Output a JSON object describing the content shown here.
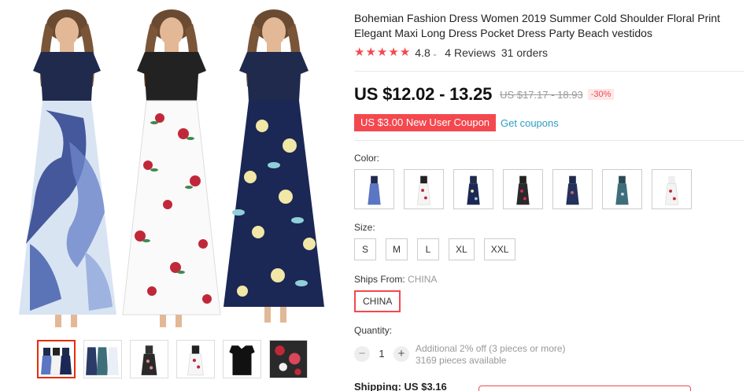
{
  "product": {
    "title": "Bohemian Fashion Dress Women 2019 Summer Cold Shoulder Floral Print Elegant Maxi Long Dress Pocket Dress Party Beach vestidos",
    "rating": "4.8",
    "reviews": "4 Reviews",
    "orders": "31 orders",
    "price": "US $12.02 - 13.25",
    "original_price": "US $17.17 - 18.93",
    "discount": "-30%",
    "coupon": "US $3.00 New User Coupon",
    "get_coupons": "Get coupons"
  },
  "colors": {
    "label": "Color:",
    "swatches": [
      {
        "name": "blue-floral"
      },
      {
        "name": "white-floral"
      },
      {
        "name": "navy-floral"
      },
      {
        "name": "black-rose"
      },
      {
        "name": "navy-print"
      },
      {
        "name": "teal-print"
      },
      {
        "name": "white-navy"
      }
    ]
  },
  "sizes": {
    "label": "Size:",
    "options": [
      "S",
      "M",
      "L",
      "XL",
      "XXL"
    ]
  },
  "ships_from": {
    "label": "Ships From:",
    "value": "CHINA",
    "option": "CHINA"
  },
  "quantity": {
    "label": "Quantity:",
    "minus": "−",
    "plus": "+",
    "value": "1",
    "note": "Additional 2% off (3 pieces or more)",
    "available": "3169 pieces available"
  },
  "shipping": {
    "text": "Shipping: US $3.16"
  },
  "theme": {
    "accent": "#f4484f",
    "link": "#2e9cc3",
    "navy": "#1f2a4d"
  }
}
